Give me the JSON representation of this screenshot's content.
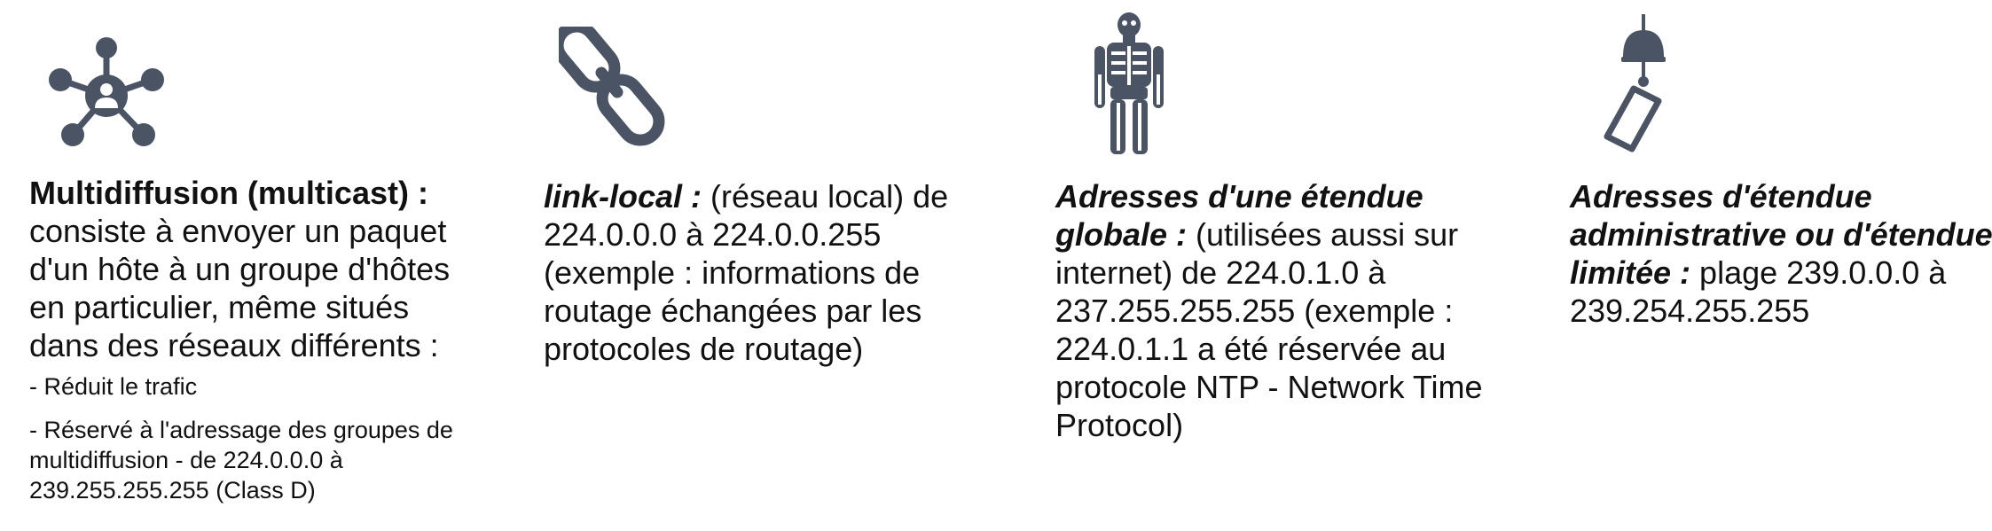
{
  "colors": {
    "icon": "#4a5464",
    "text": "#111111"
  },
  "columns": [
    {
      "icon": "network-hub-icon",
      "title": "Multidiffusion (multicast) :",
      "lines": [
        "consiste à envoyer un paquet",
        "d'un hôte à un groupe d'hôtes",
        "en particulier, même situés",
        "dans des réseaux différents :"
      ],
      "bullets": [
        "- Réduit le trafic",
        "- Réservé à l'adressage des groupes de",
        "multidiffusion - de 224.0.0.0 à",
        "239.255.255.255 (Class D)"
      ]
    },
    {
      "icon": "chain-link-icon",
      "title": "link-local :",
      "title_rest": " (réseau local) de",
      "lines": [
        "224.0.0.0 à 224.0.0.255",
        "(exemple : informations de",
        "routage échangées par les",
        "protocoles de routage)"
      ]
    },
    {
      "icon": "skeleton-icon",
      "title_line1": "Adresses d'une étendue",
      "title_line2": "globale :",
      "title_rest": " (utilisées aussi sur",
      "lines": [
        "internet) de 224.0.1.0 à",
        "237.255.255.255 (exemple :",
        "224.0.1.1 a été réservée au",
        "protocole NTP - Network Time",
        "Protocol)"
      ]
    },
    {
      "icon": "wind-chime-icon",
      "title_line1": "Adresses d'étendue",
      "title_line2": "administrative ou d'étendue",
      "title_line3": "limitée :",
      "title_rest": " plage 239.0.0.0 à",
      "lines": [
        "239.254.255.255"
      ]
    }
  ]
}
